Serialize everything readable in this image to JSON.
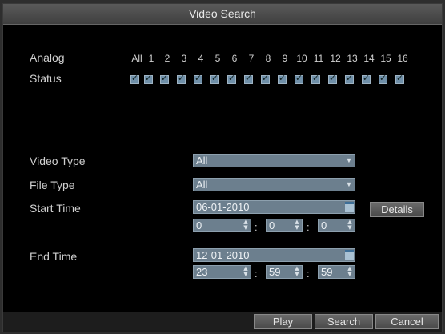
{
  "window": {
    "title": "Video Search"
  },
  "camera": {
    "analog_label": "Analog",
    "status_label": "Status",
    "channels": [
      "All",
      "1",
      "2",
      "3",
      "4",
      "5",
      "6",
      "7",
      "8",
      "9",
      "10",
      "11",
      "12",
      "13",
      "14",
      "15",
      "16"
    ]
  },
  "form": {
    "video_type_label": "Video Type",
    "video_type_value": "All",
    "file_type_label": "File Type",
    "file_type_value": "All",
    "start_time_label": "Start Time",
    "start_date": "06-01-2010",
    "start_hour": "0",
    "start_minute": "0",
    "start_second": "0",
    "end_time_label": "End Time",
    "end_date": "12-01-2010",
    "end_hour": "23",
    "end_minute": "59",
    "end_second": "59",
    "colon": ":",
    "details_label": "Details"
  },
  "footer": {
    "play_label": "Play",
    "search_label": "Search",
    "cancel_label": "Cancel"
  },
  "icons": {
    "dropdown": "dropdown-arrow-icon",
    "spinner": "spinner-arrows-icon",
    "calendar": "calendar-icon"
  }
}
